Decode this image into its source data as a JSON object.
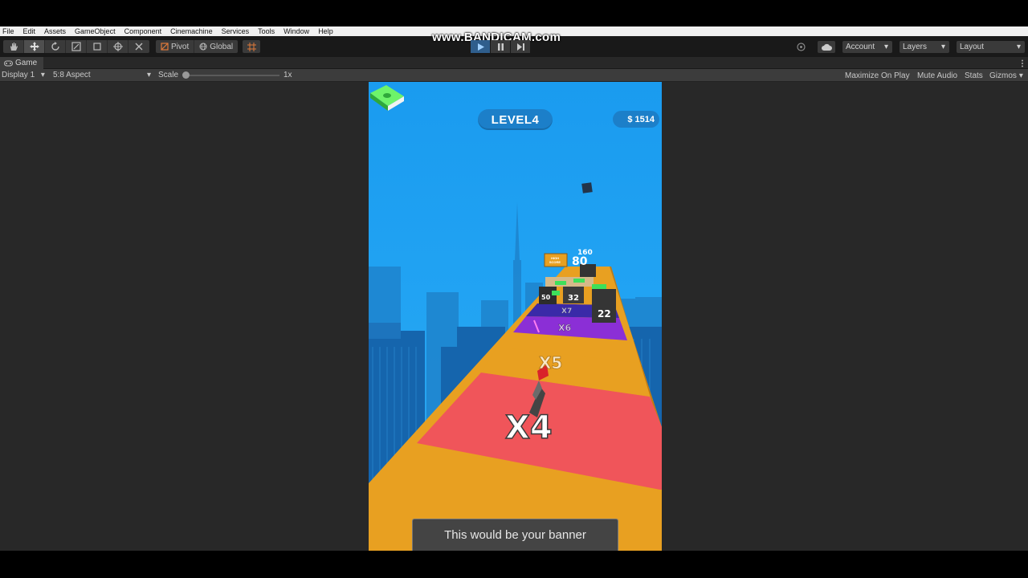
{
  "recording_watermark": "www.BANDICAM.com",
  "menu": [
    "File",
    "Edit",
    "Assets",
    "GameObject",
    "Component",
    "Cinemachine",
    "Services",
    "Tools",
    "Window",
    "Help"
  ],
  "toolbar": {
    "pivot_label": "Pivot",
    "global_label": "Global",
    "account_label": "Account",
    "layers_label": "Layers",
    "layout_label": "Layout"
  },
  "game_tab": {
    "label": "Game"
  },
  "game_bar": {
    "display": "Display 1",
    "aspect": "5:8 Aspect",
    "scale_label": "Scale",
    "scale_value": "1x",
    "maximize_on_play": "Maximize On Play",
    "mute_audio": "Mute Audio",
    "stats": "Stats",
    "gizmos": "Gizmos"
  },
  "game": {
    "level": "LEVEL4",
    "money": "$ 1514",
    "high_score_sign": "HIGH SCORE",
    "multipliers": [
      "X4",
      "X5",
      "X6",
      "X7"
    ],
    "cubes": [
      "50",
      "32",
      "22",
      "80",
      "160"
    ],
    "banner": "This would be your banner"
  },
  "colors": {
    "sky": "#1a9bef",
    "road_orange": "#e8a021",
    "road_red": "#f0555a",
    "road_purple": "#8b2fd6",
    "editor_dark": "#282828"
  }
}
